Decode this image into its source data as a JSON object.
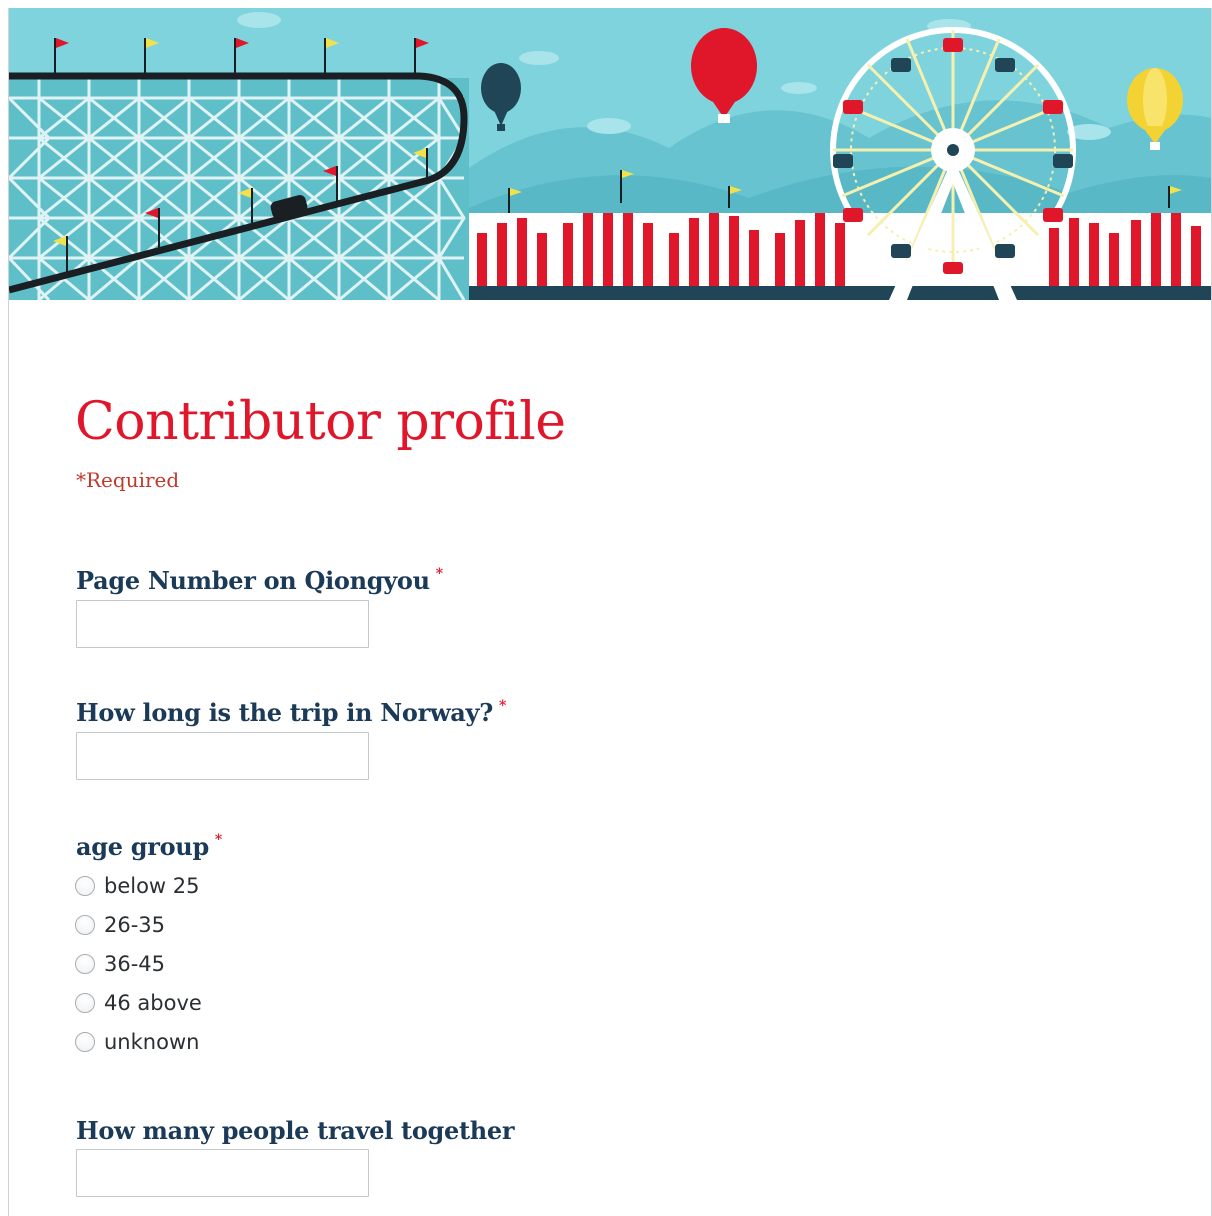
{
  "form": {
    "title": "Contributor profile",
    "required_note": "*Required",
    "required_marker": "*"
  },
  "questions": {
    "page_number": {
      "label": "Page Number on Qiongyou",
      "value": ""
    },
    "trip_length": {
      "label": "How long is the trip in Norway?",
      "value": ""
    },
    "age_group": {
      "label": "age group",
      "options": [
        "below 25",
        "26-35",
        "36-45",
        "46 above",
        "unknown"
      ]
    },
    "group_size": {
      "label": "How many people travel together",
      "value": ""
    }
  },
  "colors": {
    "title_red": "#e0162b",
    "question_navy": "#1b3a57",
    "banner_sky": "#7fd3dc",
    "banner_dark": "#1f4556"
  },
  "icons": [
    "roller-coaster-illustration",
    "hot-air-balloon-icon",
    "ferris-wheel-illustration",
    "circus-tent-illustration",
    "flag-icon"
  ]
}
